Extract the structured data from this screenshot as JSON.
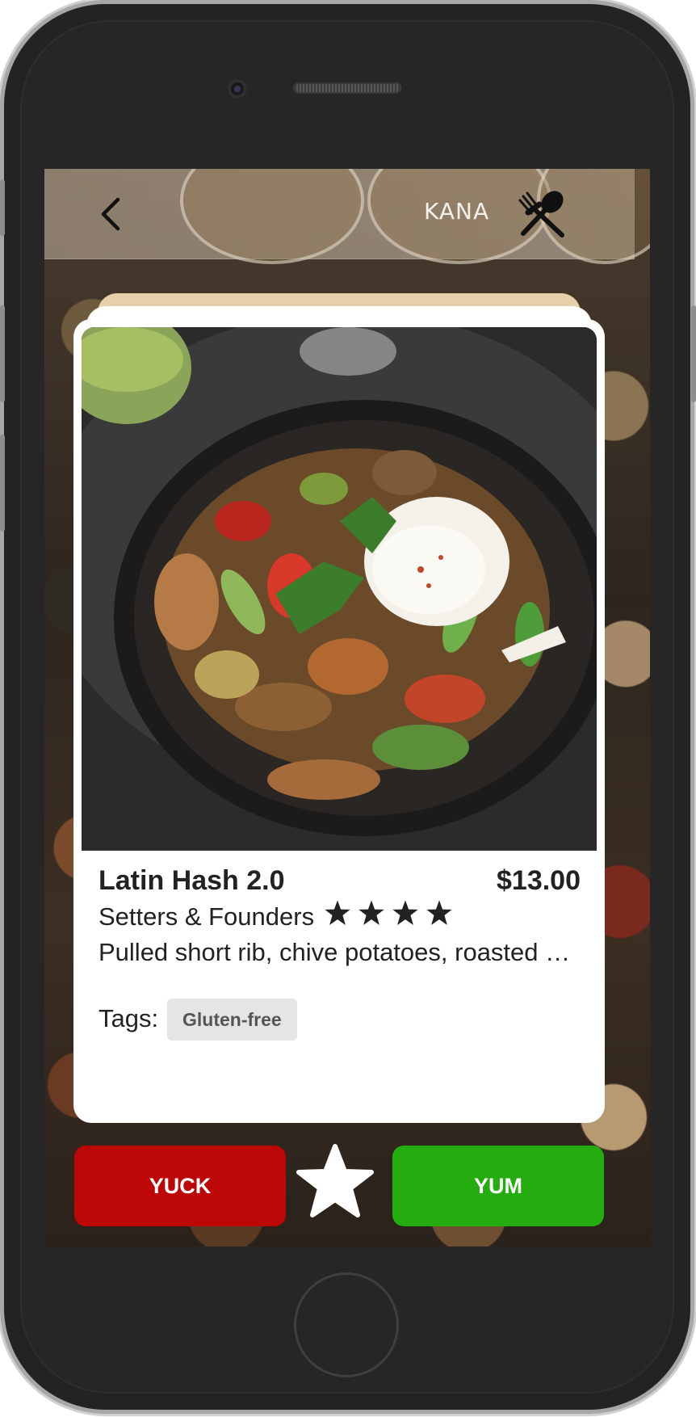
{
  "header": {
    "title": "KANA"
  },
  "icons": {
    "back": "chevron-left-icon",
    "menu": "fork-spoon-crossed-icon",
    "favorite": "star-icon",
    "rating": "star-icon"
  },
  "card": {
    "dish_name": "Latin Hash 2.0",
    "price": "$13.00",
    "restaurant": "Setters & Founders",
    "rating_stars": 4,
    "description": "Pulled short rib, chive potatoes, roasted …",
    "tags_label": "Tags:",
    "tags": [
      "Gluten-free"
    ]
  },
  "actions": {
    "yuck_label": "YUCK",
    "yum_label": "YUM"
  },
  "colors": {
    "yuck": "#bd0606",
    "yum": "#25ac0e",
    "card": "#ffffff"
  }
}
